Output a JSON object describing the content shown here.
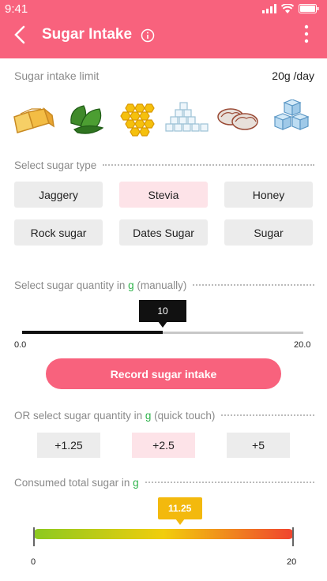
{
  "status_bar": {
    "time": "9:41"
  },
  "header": {
    "title": "Sugar Intake"
  },
  "limit": {
    "label": "Sugar intake limit",
    "value": "20g /day"
  },
  "sugar_icons": [
    "jaggery-icon",
    "stevia-leaf-icon",
    "honeycomb-icon",
    "rock-sugar-icon",
    "dates-icon",
    "sugar-cubes-icon"
  ],
  "select_type": {
    "label": "Select sugar type",
    "options": [
      "Jaggery",
      "Stevia",
      "Honey",
      "Rock sugar",
      "Dates Sugar",
      "Sugar"
    ],
    "selected": "Stevia"
  },
  "manual": {
    "label_prefix": "Select sugar quantity in ",
    "unit": "g",
    "label_suffix": " (manually)",
    "value": "10",
    "min": "0.0",
    "max": "20.0"
  },
  "record_button": "Record sugar intake",
  "quick": {
    "label_prefix": "OR select sugar quantity in ",
    "unit": "g",
    "label_suffix": " (quick touch)",
    "options": [
      "+1.25",
      "+2.5",
      "+5"
    ],
    "selected": "+2.5"
  },
  "consumed": {
    "label_prefix": "Consumed total sugar in ",
    "unit": "g",
    "value": "11.25",
    "min": "0",
    "max": "20"
  },
  "colors": {
    "accent": "#f8627d",
    "selected_bg": "#fde3e8",
    "button_bg": "#ececec",
    "unit_green": "#2db34a",
    "gauge_tip": "#f3b90d"
  }
}
